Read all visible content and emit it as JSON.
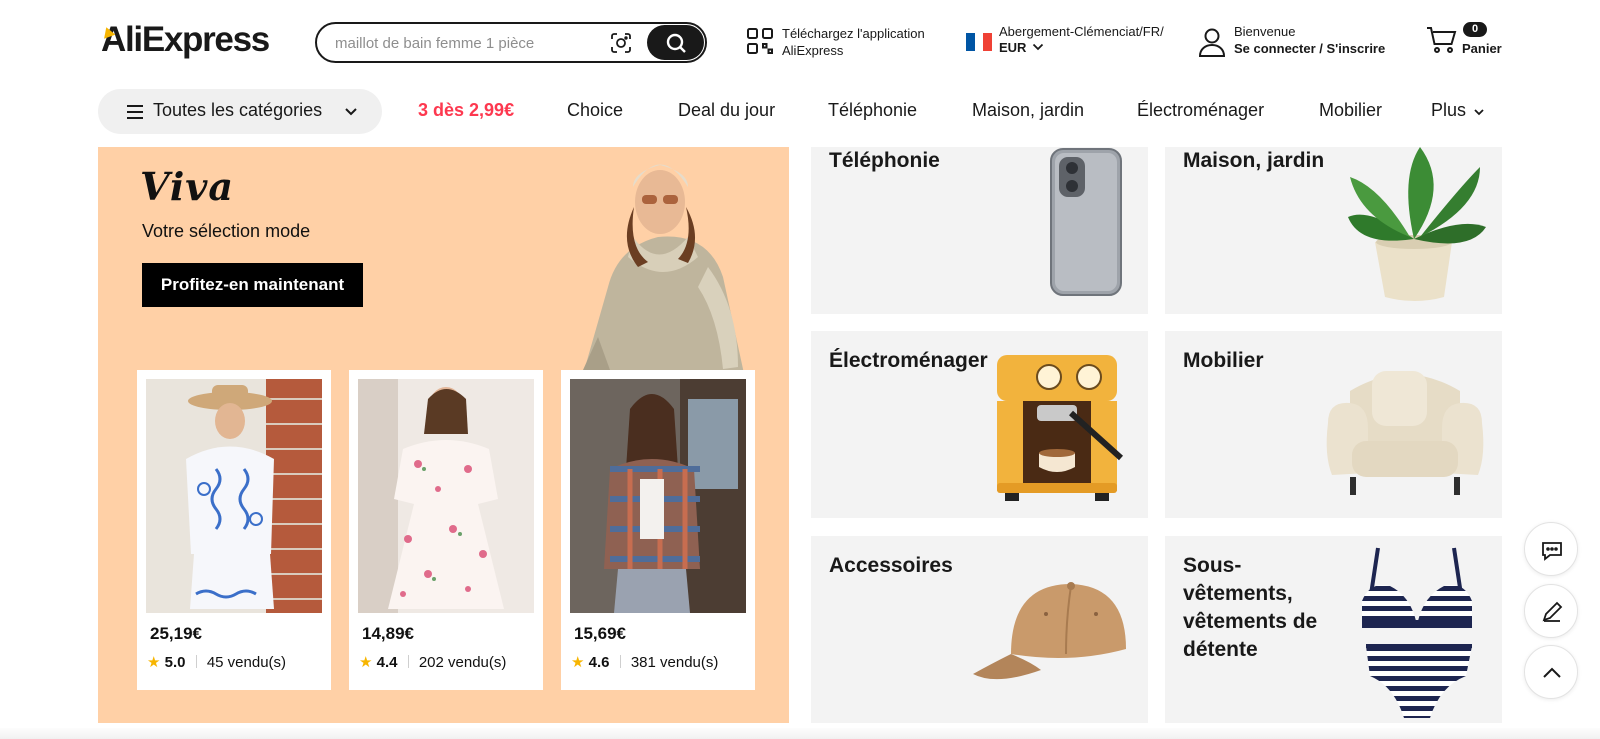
{
  "header": {
    "logo": "AliExpress",
    "search": {
      "placeholder": "maillot de bain femme 1 pièce",
      "value": ""
    },
    "app_download": {
      "line1": "Téléchargez l'application",
      "line2": "AliExpress"
    },
    "region": {
      "location": "Abergement-Clémenciat/FR/",
      "currency": "EUR",
      "flag_colors": [
        "#0055a4",
        "#ffffff",
        "#ef4135"
      ]
    },
    "account": {
      "greeting": "Bienvenue",
      "action": "Se connecter / S'inscrire"
    },
    "cart": {
      "count": "0",
      "label": "Panier"
    }
  },
  "nav": {
    "all_categories": "Toutes les catégories",
    "links": [
      {
        "label": "3 dès 2,99€",
        "promo": true
      },
      {
        "label": "Choice"
      },
      {
        "label": "Deal du jour"
      },
      {
        "label": "Téléphonie"
      },
      {
        "label": "Maison, jardin"
      },
      {
        "label": "Électroménager"
      },
      {
        "label": "Mobilier"
      },
      {
        "label": "Plus"
      }
    ]
  },
  "banner": {
    "title": "Viva",
    "subtitle": "Votre sélection mode",
    "cta": "Profitez-en maintenant",
    "background": "#ffd0a6",
    "products": [
      {
        "price": "25,19€",
        "rating": "5.0",
        "sold": "45 vendu(s)"
      },
      {
        "price": "14,89€",
        "rating": "4.4",
        "sold": "202 vendu(s)"
      },
      {
        "price": "15,69€",
        "rating": "4.6",
        "sold": "381 vendu(s)"
      }
    ]
  },
  "categories": [
    {
      "name": "Téléphonie"
    },
    {
      "name": "Maison, jardin"
    },
    {
      "name": "Électroménager"
    },
    {
      "name": "Mobilier"
    },
    {
      "name": "Accessoires"
    },
    {
      "name": "Sous-vêtements, vêtements de détente"
    }
  ],
  "colors": {
    "accent": "#fd384f",
    "star": "#f7b500",
    "dark": "#191919"
  }
}
